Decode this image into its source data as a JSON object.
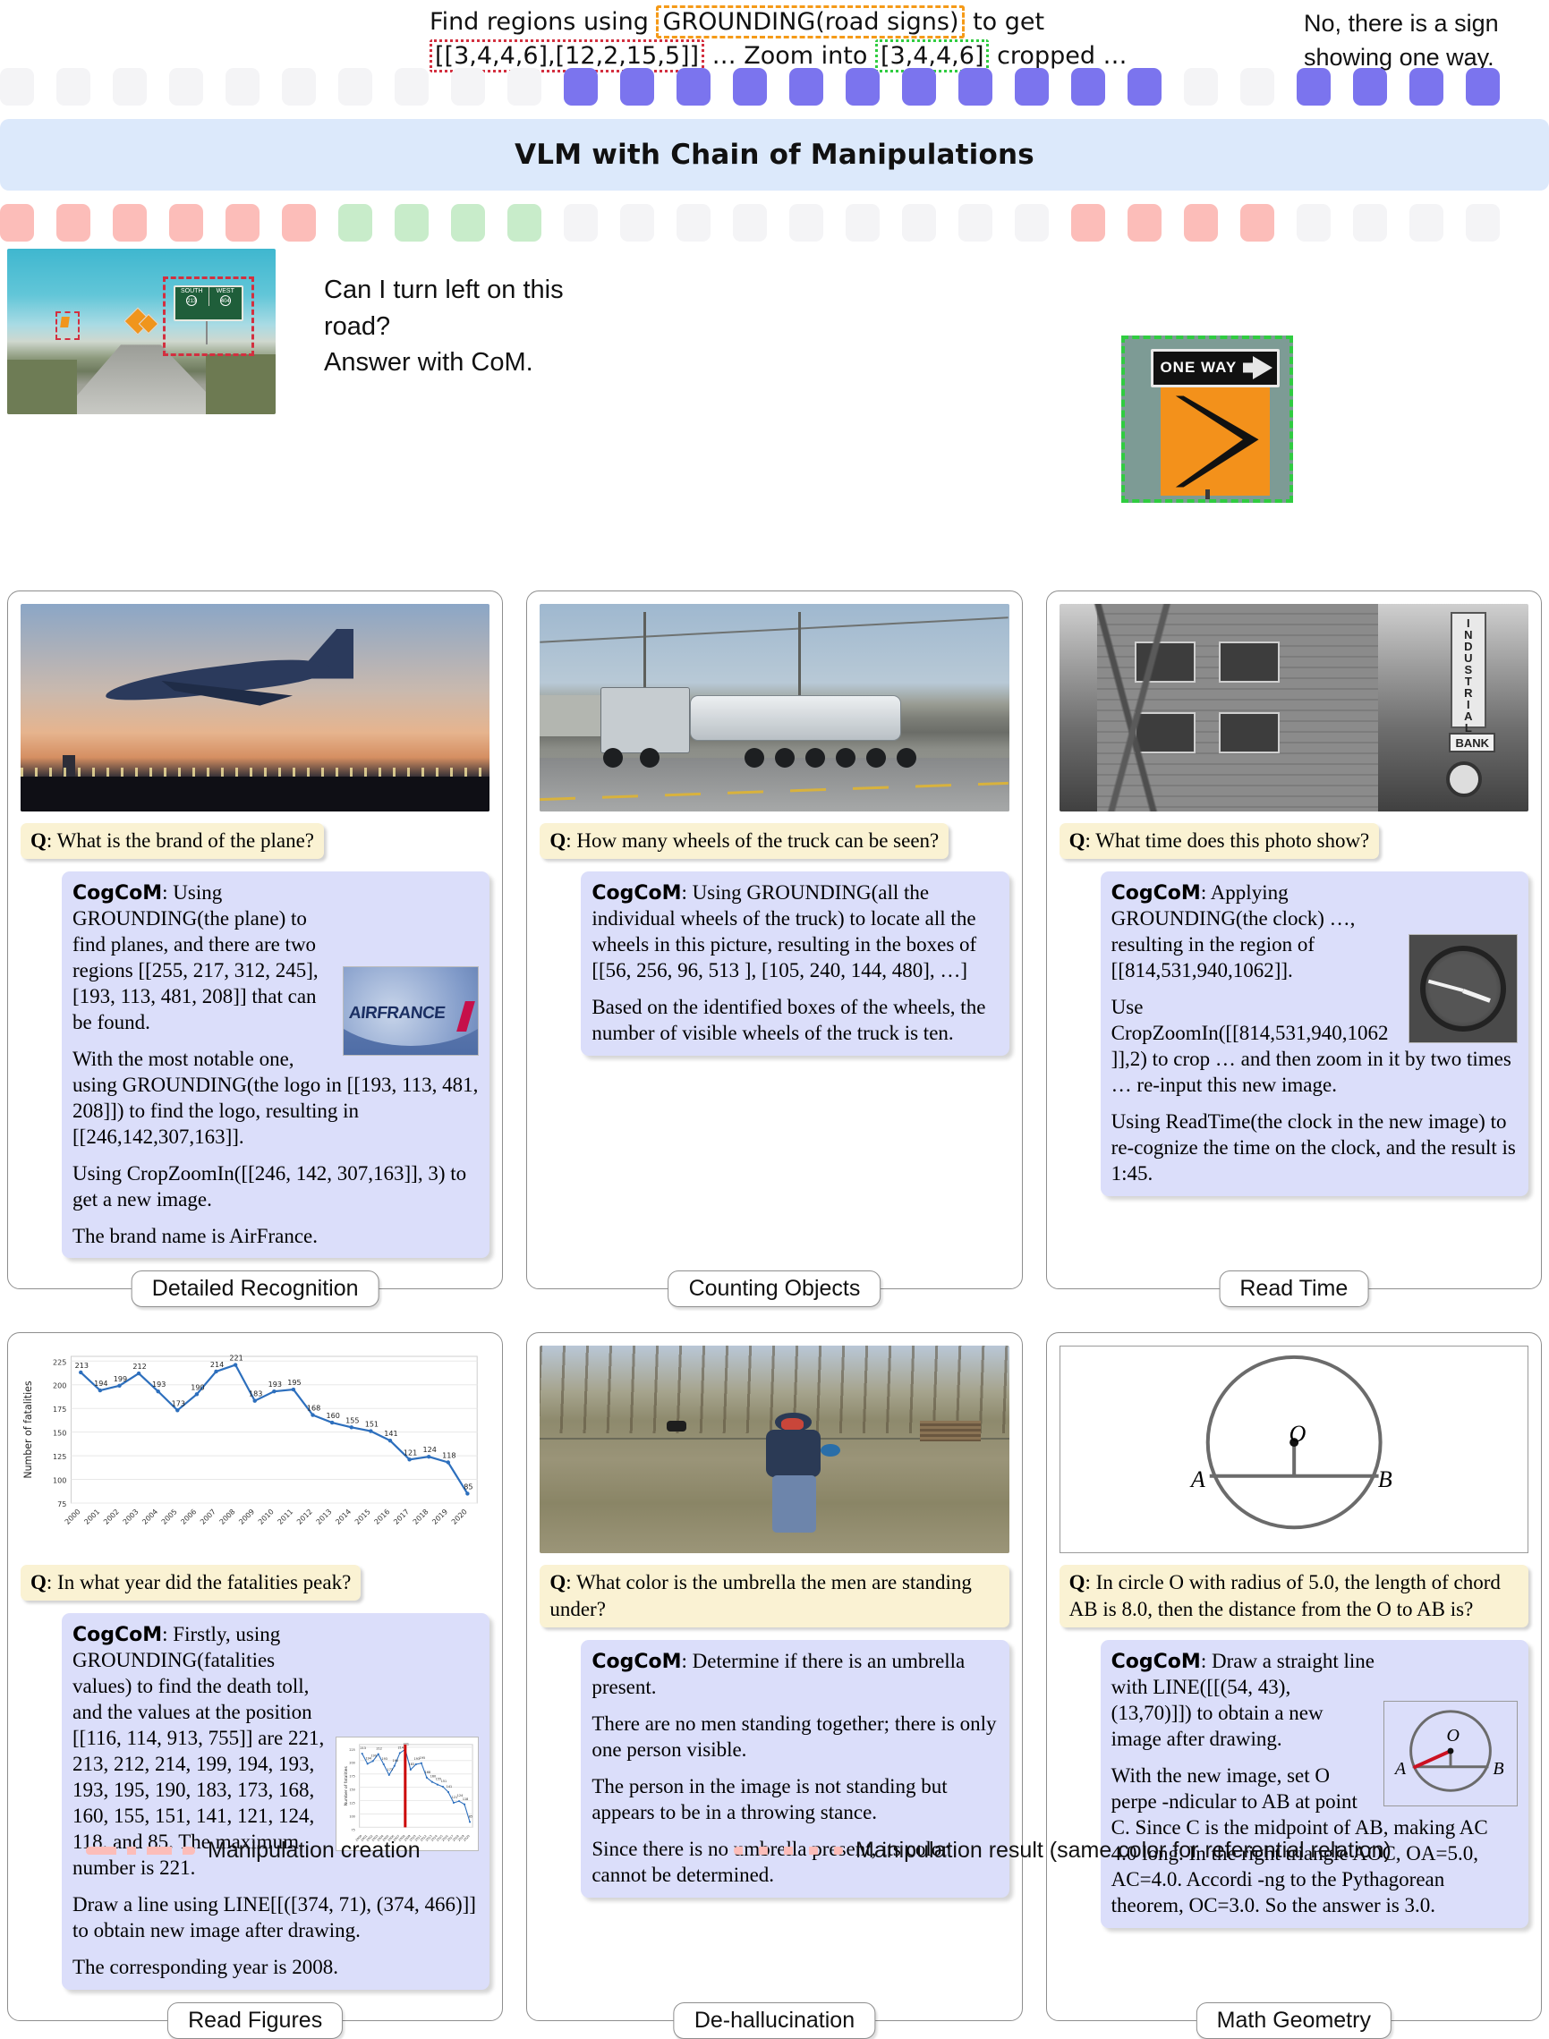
{
  "top": {
    "prompt_line1_a": "Find regions using ",
    "prompt_line1_box": "GROUNDING(road signs)",
    "prompt_line1_b": " to get",
    "prompt_line2_box1": "[[3,4,4,6],[12,2,15,5]]",
    "prompt_line2_mid": " … Zoom into ",
    "prompt_line2_box2": "[3,4,4,6]",
    "prompt_line2_end": " cropped …",
    "answer_right": "No, there is a sign showing one way."
  },
  "banner": {
    "title": "VLM with Chain of Manipulations"
  },
  "demo": {
    "question": "Can I turn left on this road?\nAnswer with CoM.",
    "road_sign_left_label": "SOUTH",
    "road_sign_left_num": "213",
    "road_sign_right_label": "WEST",
    "road_sign_right_num": "404",
    "oneway_text": "ONE WAY"
  },
  "colors": {
    "token_purple": "#7b74ee",
    "token_pink": "#fcbdb9",
    "token_green": "#c8ecca",
    "token_blank": "#f4f4f6",
    "banner_bg": "#dce9fb",
    "question_bg": "#faf2d3",
    "answer_bg": "#dbdefa",
    "box_orange": "#f59a18",
    "box_red": "#d32f3f",
    "box_green": "#2fcc40"
  },
  "panels": [
    {
      "tag": "Detailed Recognition",
      "question_prefix": "Q",
      "question": ": What is the brand of the plane?",
      "answer_label": "CogCoM",
      "paragraphs": [
        ": Using GROUNDING(the plane) to find planes, and there are two regions [[255, 217, 312, 245], [193, 113, 481, 208]] that can be found.",
        "With the most notable one, using GROUNDING(the logo in [[193, 113, 481, 208]]) to find the logo, resulting in [[246,142,307,163]].",
        "Using CropZoomIn([[246, 142, 307,163]], 3) to get a new image.",
        "The brand name is AirFrance."
      ],
      "thumb_text": "AIRFRANCE"
    },
    {
      "tag": "Counting Objects",
      "question_prefix": "Q",
      "question": ": How many wheels of the truck can be seen?",
      "answer_label": "CogCoM",
      "paragraphs": [
        ": Using GROUNDING(all the individual wheels of the truck) to locate all the wheels in this picture, resulting in the boxes of [[56, 256, 96, 513 ], [105, 240, 144, 480], …]",
        "Based on the identified boxes of the wheels, the number of visible wheels of the truck is ten."
      ],
      "thumb_text": ""
    },
    {
      "tag": "Read Time",
      "question_prefix": "Q",
      "question": ": What time does this photo show?",
      "answer_label": "CogCoM",
      "paragraphs": [
        ": Applying GROUNDING(the clock) …, resulting in the region of [[814,531,940,1062]].",
        "Use CropZoomIn([[814,531,940,1062 ]],2) to crop … and then zoom in it by two times … re-input this new image.",
        "Using ReadTime(the clock in the new image) to re-cognize the time on the clock, and the result is 1:45."
      ],
      "sign_vertical": "INDUSTRIAL",
      "sign_bank": "BANK",
      "clock_time": "1:45"
    },
    {
      "tag": "Read Figures",
      "question_prefix": "Q",
      "question": ": In what year did the fatalities peak?",
      "answer_label": "CogCoM",
      "paragraphs": [
        ": Firstly, using GROUNDING(fatalities values) to find the death toll, and the values at the position [[116, 114, 913, 755]] are 221, 213, 212, 214, 199, 194, 193, 193, 195, 190, 183, 173, 168, 160, 155, 151, 141, 121, 124, 118, and 85. The maximum number is 221.",
        "Draw a line using LINE[[([374, 71), (374, 466)]] to obtain new image after drawing.",
        "The corresponding year is 2008."
      ]
    },
    {
      "tag": "De-hallucination",
      "question_prefix": "Q",
      "question": ": What color is the umbrella the men are standing under?",
      "answer_label": "CogCoM",
      "paragraphs": [
        ": Determine if there is an umbrella present.",
        "There are no men standing together; there is only one person visible.",
        "The person in the image is not standing but appears to be in a throwing stance.",
        "Since there is no umbrella present, its color cannot be determined."
      ]
    },
    {
      "tag": "Math Geometry",
      "question_prefix": "Q",
      "question": ": In circle O with radius of 5.0, the length of chord AB is 8.0, then the distance from the O to AB is?",
      "answer_label": "CogCoM",
      "paragraphs": [
        ": Draw a straight line with LINE([[(54, 43), (13,70)]]) to obtain a new image after drawing.",
        "With the new image, set O perpe -ndicular to AB at point C. Since C is the midpoint of AB, making AC 4.0 long. In the right triangle AOC, OA=5.0, AC=4.0. Accordi -ng to the Pythagorean theorem, OC=3.0. So the answer is 3.0."
      ],
      "label_O": "O",
      "label_A": "A",
      "label_B": "B"
    }
  ],
  "legend": {
    "creation": "Manipulation creation",
    "result": "Manipulation result (same color for referential relation)"
  },
  "chart_data": {
    "type": "line",
    "title": "",
    "xlabel": "",
    "ylabel": "Number of fatalities",
    "categories": [
      "2000",
      "2001",
      "2002",
      "2003",
      "2004",
      "2005",
      "2006",
      "2007",
      "2008",
      "2009",
      "2010",
      "2011",
      "2012",
      "2013",
      "2014",
      "2015",
      "2016",
      "2017",
      "2018",
      "2019",
      "2020"
    ],
    "values": [
      213,
      194,
      199,
      212,
      193,
      173,
      190,
      214,
      221,
      183,
      193,
      195,
      168,
      160,
      155,
      151,
      141,
      121,
      124,
      118,
      85
    ],
    "ylim": [
      75,
      230
    ],
    "yticks": [
      75,
      100,
      125,
      150,
      175,
      200,
      225
    ],
    "grid": true,
    "legend_position": "none",
    "peak_year": "2008",
    "peak_value": 221,
    "annotation_line_x": "2008"
  }
}
